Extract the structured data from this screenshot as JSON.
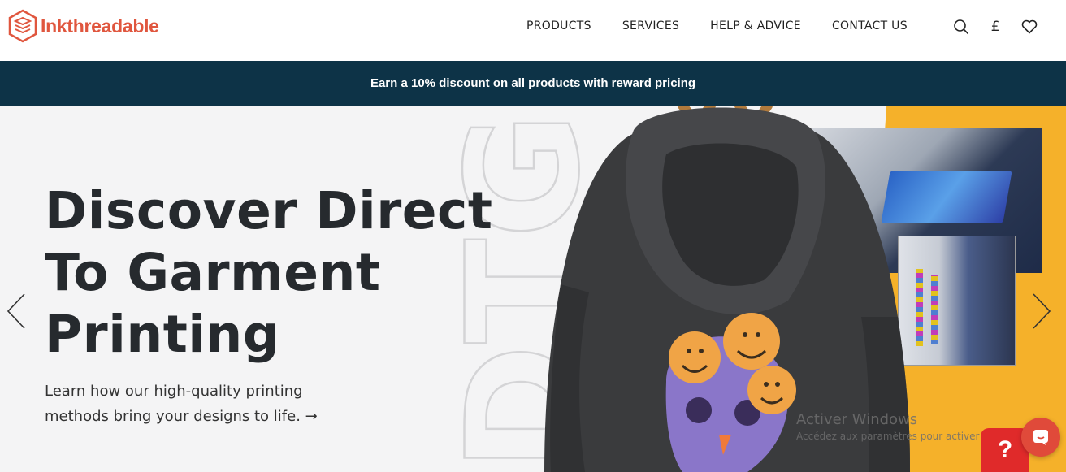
{
  "brand": {
    "name": "Inkthreadable",
    "color": "#e0563e"
  },
  "nav": {
    "items": [
      {
        "label": "PRODUCTS"
      },
      {
        "label": "SERVICES"
      },
      {
        "label": "HELP & ADVICE"
      },
      {
        "label": "CONTACT US"
      }
    ],
    "currency_symbol": "£",
    "icons": [
      "search-icon",
      "currency-icon",
      "heart-icon"
    ]
  },
  "banner": {
    "text": "Earn a 10% discount on all products with reward pricing",
    "bg": "#0d3347"
  },
  "hero": {
    "title_lines": [
      "Discover Direct",
      "To Garment",
      "Printing"
    ],
    "subtitle_lines": [
      "Learn how our high-quality printing",
      "methods bring your designs to life. →"
    ],
    "background_text": "DTG",
    "accent": "#f5b12a"
  },
  "overlay": {
    "watermark_title": "Activer Windows",
    "watermark_sub": "Accédez aux paramètres pour activer Windows."
  },
  "widgets": {
    "help_label": "?"
  }
}
